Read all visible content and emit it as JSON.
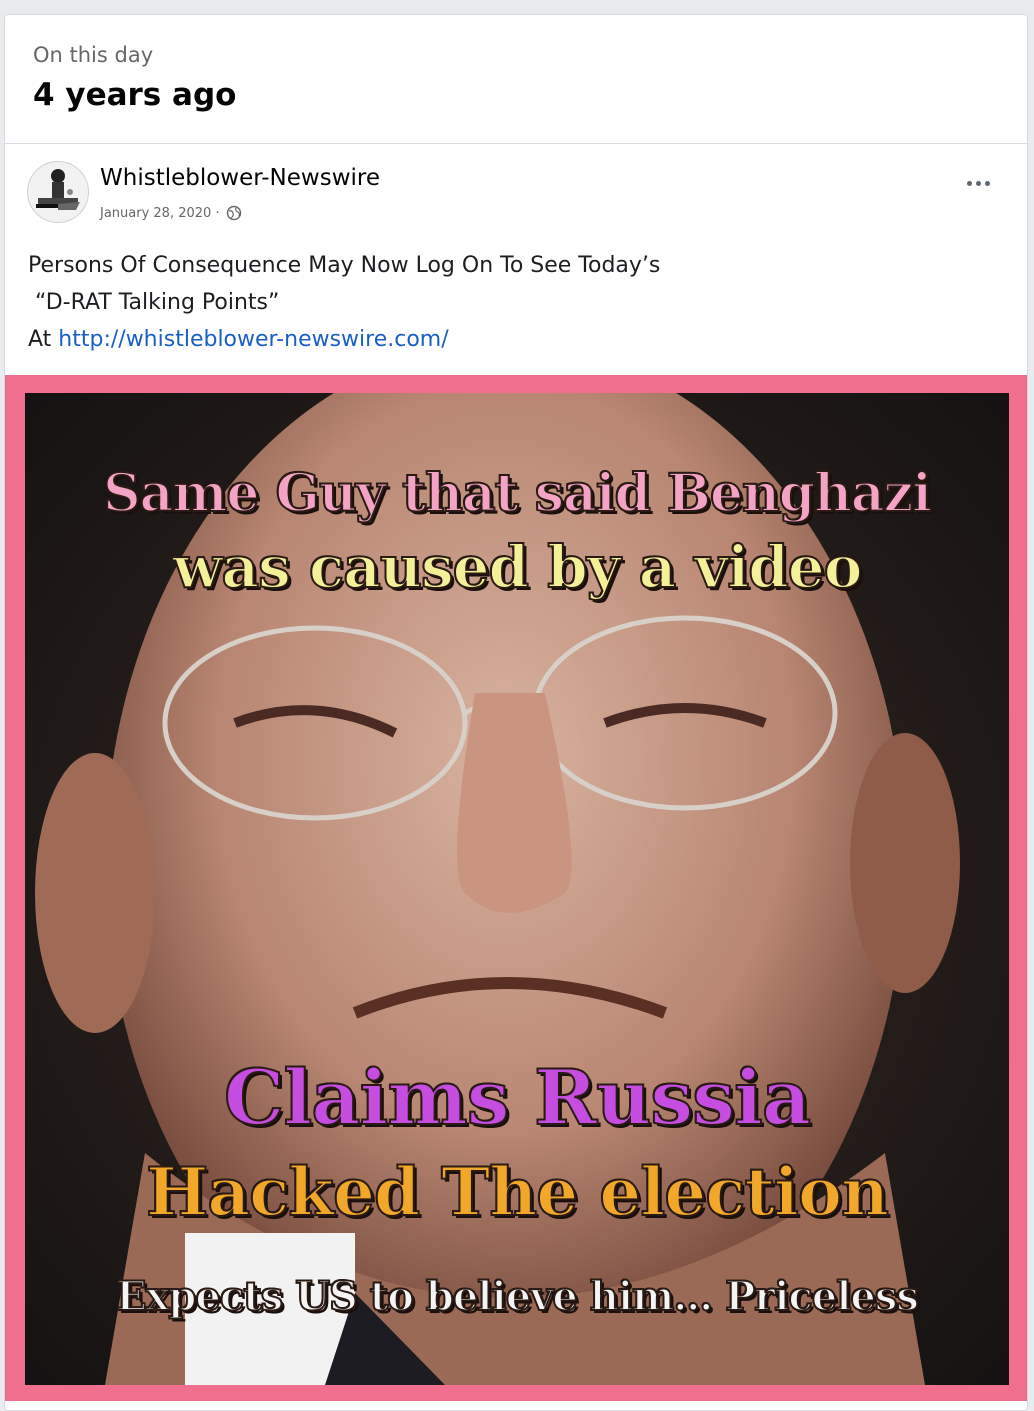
{
  "memory": {
    "subtitle": "On this day",
    "title": "4 years ago"
  },
  "post": {
    "author": "Whistleblower-Newswire",
    "date": "January 28, 2020 ·",
    "text_line1": "Persons Of Consequence May Now Log On To See Today’s",
    "text_line2": " “D-RAT Talking Points”",
    "text_prefix": "At ",
    "link": "http://whistleblower-newswire.com/",
    "icons": {
      "privacy": "globe-icon",
      "more": "more-options-icon",
      "avatar": "page-avatar"
    }
  },
  "meme": {
    "line1": "Same Guy that said Benghazi",
    "line2": "was caused by a video",
    "line3": "Claims  Russia",
    "line4": "Hacked The election",
    "line5": "Expects US to believe him... Priceless",
    "frame_color": "#f06e8e"
  }
}
